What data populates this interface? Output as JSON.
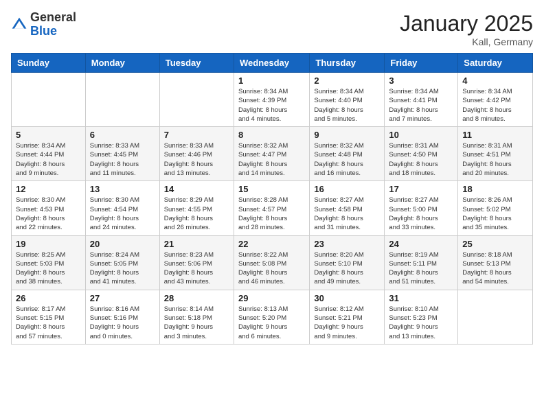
{
  "logo": {
    "general": "General",
    "blue": "Blue"
  },
  "title": "January 2025",
  "location": "Kall, Germany",
  "weekdays": [
    "Sunday",
    "Monday",
    "Tuesday",
    "Wednesday",
    "Thursday",
    "Friday",
    "Saturday"
  ],
  "weeks": [
    [
      {
        "day": "",
        "info": ""
      },
      {
        "day": "",
        "info": ""
      },
      {
        "day": "",
        "info": ""
      },
      {
        "day": "1",
        "info": "Sunrise: 8:34 AM\nSunset: 4:39 PM\nDaylight: 8 hours\nand 4 minutes."
      },
      {
        "day": "2",
        "info": "Sunrise: 8:34 AM\nSunset: 4:40 PM\nDaylight: 8 hours\nand 5 minutes."
      },
      {
        "day": "3",
        "info": "Sunrise: 8:34 AM\nSunset: 4:41 PM\nDaylight: 8 hours\nand 7 minutes."
      },
      {
        "day": "4",
        "info": "Sunrise: 8:34 AM\nSunset: 4:42 PM\nDaylight: 8 hours\nand 8 minutes."
      }
    ],
    [
      {
        "day": "5",
        "info": "Sunrise: 8:34 AM\nSunset: 4:44 PM\nDaylight: 8 hours\nand 9 minutes."
      },
      {
        "day": "6",
        "info": "Sunrise: 8:33 AM\nSunset: 4:45 PM\nDaylight: 8 hours\nand 11 minutes."
      },
      {
        "day": "7",
        "info": "Sunrise: 8:33 AM\nSunset: 4:46 PM\nDaylight: 8 hours\nand 13 minutes."
      },
      {
        "day": "8",
        "info": "Sunrise: 8:32 AM\nSunset: 4:47 PM\nDaylight: 8 hours\nand 14 minutes."
      },
      {
        "day": "9",
        "info": "Sunrise: 8:32 AM\nSunset: 4:48 PM\nDaylight: 8 hours\nand 16 minutes."
      },
      {
        "day": "10",
        "info": "Sunrise: 8:31 AM\nSunset: 4:50 PM\nDaylight: 8 hours\nand 18 minutes."
      },
      {
        "day": "11",
        "info": "Sunrise: 8:31 AM\nSunset: 4:51 PM\nDaylight: 8 hours\nand 20 minutes."
      }
    ],
    [
      {
        "day": "12",
        "info": "Sunrise: 8:30 AM\nSunset: 4:53 PM\nDaylight: 8 hours\nand 22 minutes."
      },
      {
        "day": "13",
        "info": "Sunrise: 8:30 AM\nSunset: 4:54 PM\nDaylight: 8 hours\nand 24 minutes."
      },
      {
        "day": "14",
        "info": "Sunrise: 8:29 AM\nSunset: 4:55 PM\nDaylight: 8 hours\nand 26 minutes."
      },
      {
        "day": "15",
        "info": "Sunrise: 8:28 AM\nSunset: 4:57 PM\nDaylight: 8 hours\nand 28 minutes."
      },
      {
        "day": "16",
        "info": "Sunrise: 8:27 AM\nSunset: 4:58 PM\nDaylight: 8 hours\nand 31 minutes."
      },
      {
        "day": "17",
        "info": "Sunrise: 8:27 AM\nSunset: 5:00 PM\nDaylight: 8 hours\nand 33 minutes."
      },
      {
        "day": "18",
        "info": "Sunrise: 8:26 AM\nSunset: 5:02 PM\nDaylight: 8 hours\nand 35 minutes."
      }
    ],
    [
      {
        "day": "19",
        "info": "Sunrise: 8:25 AM\nSunset: 5:03 PM\nDaylight: 8 hours\nand 38 minutes."
      },
      {
        "day": "20",
        "info": "Sunrise: 8:24 AM\nSunset: 5:05 PM\nDaylight: 8 hours\nand 41 minutes."
      },
      {
        "day": "21",
        "info": "Sunrise: 8:23 AM\nSunset: 5:06 PM\nDaylight: 8 hours\nand 43 minutes."
      },
      {
        "day": "22",
        "info": "Sunrise: 8:22 AM\nSunset: 5:08 PM\nDaylight: 8 hours\nand 46 minutes."
      },
      {
        "day": "23",
        "info": "Sunrise: 8:20 AM\nSunset: 5:10 PM\nDaylight: 8 hours\nand 49 minutes."
      },
      {
        "day": "24",
        "info": "Sunrise: 8:19 AM\nSunset: 5:11 PM\nDaylight: 8 hours\nand 51 minutes."
      },
      {
        "day": "25",
        "info": "Sunrise: 8:18 AM\nSunset: 5:13 PM\nDaylight: 8 hours\nand 54 minutes."
      }
    ],
    [
      {
        "day": "26",
        "info": "Sunrise: 8:17 AM\nSunset: 5:15 PM\nDaylight: 8 hours\nand 57 minutes."
      },
      {
        "day": "27",
        "info": "Sunrise: 8:16 AM\nSunset: 5:16 PM\nDaylight: 9 hours\nand 0 minutes."
      },
      {
        "day": "28",
        "info": "Sunrise: 8:14 AM\nSunset: 5:18 PM\nDaylight: 9 hours\nand 3 minutes."
      },
      {
        "day": "29",
        "info": "Sunrise: 8:13 AM\nSunset: 5:20 PM\nDaylight: 9 hours\nand 6 minutes."
      },
      {
        "day": "30",
        "info": "Sunrise: 8:12 AM\nSunset: 5:21 PM\nDaylight: 9 hours\nand 9 minutes."
      },
      {
        "day": "31",
        "info": "Sunrise: 8:10 AM\nSunset: 5:23 PM\nDaylight: 9 hours\nand 13 minutes."
      },
      {
        "day": "",
        "info": ""
      }
    ]
  ]
}
